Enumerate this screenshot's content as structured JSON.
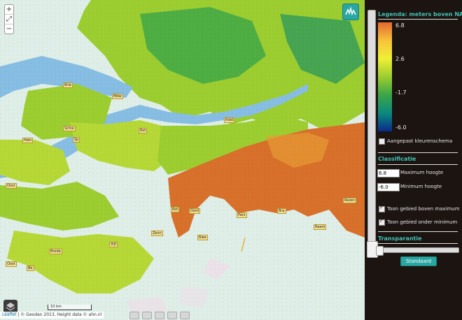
{
  "map": {
    "zoom_in": "+",
    "zoom_out": "−",
    "scale_label": "10 km",
    "attribution_link": "Leaflet",
    "attribution_text": " | © Geodan 2013, Height data © ahn.nl",
    "place_labels": [
      "Brie",
      "Mdw",
      "Schie",
      "Rot",
      "Heln",
      "Sp",
      "Ridd",
      "Oost",
      "Rozen",
      "Dord",
      "Rot",
      "Pars",
      "Bra",
      "Zevn",
      "Raam",
      "Rwe",
      "Vijf",
      "Breda",
      "Oost",
      "Be"
    ],
    "colors": {
      "water": "#86bde5",
      "sea": "#d8eee7",
      "low": "#3aa548",
      "mid": "#9ccd30",
      "high": "#d86f2a"
    }
  },
  "legend": {
    "title": "Legenda: meters boven NAP",
    "ticks": [
      "6.8",
      "2.6",
      "-1.7",
      "-6.0"
    ],
    "gradient": [
      "#e2692f",
      "#f7c23a",
      "#eef035",
      "#9ccd30",
      "#3aa548",
      "#0b8a7e",
      "#0a2a8c"
    ],
    "custom_scheme_label": "Aangepast kleurenschema",
    "custom_scheme_checked": false
  },
  "classification": {
    "title": "Classificatie",
    "max_value": "6.8",
    "max_label": "Maximum hoogte",
    "min_value": "-6.0",
    "min_label": "Minimum hoogte",
    "show_above_label": "Toon gebied boven maximum",
    "show_above_checked": true,
    "show_below_label": "Toon gebied onder minimum",
    "show_below_checked": true
  },
  "transparency": {
    "title": "Transparantie",
    "value": 0,
    "reset_label": "Standaard"
  },
  "colors": {
    "accent": "#2aa7a2",
    "panel_bg": "#1b1410",
    "title": "#42c0b4"
  }
}
